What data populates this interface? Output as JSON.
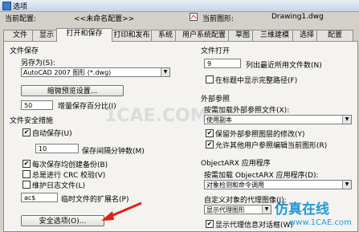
{
  "window": {
    "title": "选项"
  },
  "profile": {
    "label": "当前配置:",
    "value": "<<未命名配置>>"
  },
  "drawing": {
    "label": "当前图形:",
    "value": "Drawing1.dwg"
  },
  "tabs": [
    "文件",
    "显示",
    "打开和保存",
    "打印和发布",
    "系统",
    "用户系统配置",
    "草图",
    "三维建模",
    "选择",
    "配置"
  ],
  "active_tab": "打开和保存",
  "file_save": {
    "title": "文件保存",
    "saveas_label": "另存为(S):",
    "saveas_value": "AutoCAD 2007 图形 (*.dwg)",
    "thumb_button": "缩微预览设置...",
    "incremental_value": "50",
    "incremental_label": "增量保存百分比(I)"
  },
  "file_safety": {
    "title": "文件安全措施",
    "autosave_label": "自动保存(U)",
    "autosave_minutes": "10",
    "autosave_minutes_label": "保存间隔分钟数(M)",
    "backup_label": "每次保存均创建备份(B)",
    "crc_label": "总是进行 CRC 校验(V)",
    "log_label": "维护日志文件(L)",
    "tempext_value": "ac$",
    "tempext_label": "临时文件的扩展名(P)",
    "security_button": "安全选项(O)..."
  },
  "file_open": {
    "title": "文件打开",
    "recent_value": "9",
    "recent_label": "列出最近所用文件数(N)",
    "fullpath_label": "在标题中显示完整路径(F)"
  },
  "xref": {
    "title": "外部参照",
    "demand_label": "按需加载外部参照文件(X):",
    "demand_value": "使用副本",
    "retain_label": "保留外部参照图层的修改(Y)",
    "allow_label": "允许其他用户参照编辑当前图形(R)"
  },
  "objectarx": {
    "title": "ObjectARX 应用程序",
    "demand_label": "按需加载 ObjectARX 应用程序(D):",
    "demand_value": "对象检测和命令调用",
    "proxy_label": "自定义对象的代理图像(J):",
    "proxy_value": "显示代理图形",
    "notice_label": "显示代理信息对话框(W)"
  },
  "watermark": {
    "center": "1CAE.COM",
    "cn": "仿真在线",
    "url": "www.1CAE.com"
  },
  "colors": {
    "arrow": "#e0201a",
    "accent": "#1f9ad6"
  },
  "icons": {
    "dropdown": "chevron-down-icon",
    "checkbox": "check-icon"
  }
}
